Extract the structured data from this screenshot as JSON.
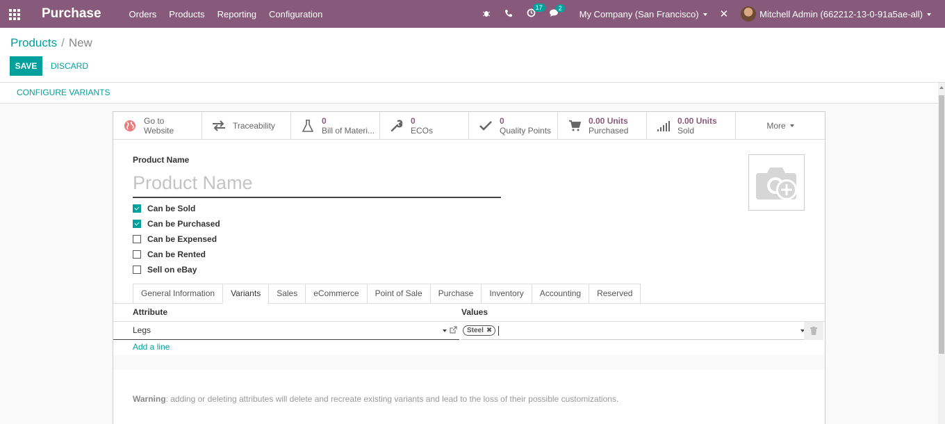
{
  "topbar": {
    "app_name": "Purchase",
    "menu": [
      "Orders",
      "Products",
      "Reporting",
      "Configuration"
    ],
    "activity_count": "17",
    "messages_count": "2",
    "company": "My Company (San Francisco)",
    "user": "Mitchell Admin (662212-13-0-91a5ae-all)"
  },
  "breadcrumb": {
    "parent": "Products",
    "separator": "/",
    "current": "New"
  },
  "actions": {
    "save": "SAVE",
    "discard": "DISCARD"
  },
  "statusbar": {
    "configure": "CONFIGURE VARIANTS"
  },
  "smart_buttons": [
    {
      "value": "",
      "line1": "Go to",
      "line2": "Website",
      "icon": "globe-icon"
    },
    {
      "value": "",
      "line1": "",
      "line2": "Traceability",
      "icon": "arrows-icon"
    },
    {
      "value": "0",
      "line1": "",
      "line2": "Bill of Materi...",
      "icon": "flask-icon"
    },
    {
      "value": "0",
      "line1": "",
      "line2": "ECOs",
      "icon": "wrench-icon"
    },
    {
      "value": "0",
      "line1": "",
      "line2": "Quality Points",
      "icon": "check-icon"
    },
    {
      "value": "0.00 Units",
      "line1": "",
      "line2": "Purchased",
      "icon": "cart-icon"
    },
    {
      "value": "0.00 Units",
      "line1": "",
      "line2": "Sold",
      "icon": "signal-icon"
    }
  ],
  "more_label": "More",
  "form": {
    "name_label": "Product Name",
    "name_placeholder": "Product Name",
    "checkboxes": [
      {
        "label": "Can be Sold",
        "checked": true
      },
      {
        "label": "Can be Purchased",
        "checked": true
      },
      {
        "label": "Can be Expensed",
        "checked": false
      },
      {
        "label": "Can be Rented",
        "checked": false
      },
      {
        "label": "Sell on eBay",
        "checked": false
      }
    ]
  },
  "tabs": [
    "General Information",
    "Variants",
    "Sales",
    "eCommerce",
    "Point of Sale",
    "Purchase",
    "Inventory",
    "Accounting",
    "Reserved"
  ],
  "active_tab": "Variants",
  "variants": {
    "col_attribute": "Attribute",
    "col_values": "Values",
    "row": {
      "attribute": "Legs",
      "value_tag": "Steel"
    },
    "add_line": "Add a line",
    "warning_title": "Warning",
    "warning_text": ": adding or deleting attributes will delete and recreate existing variants and lead to the loss of their possible customizations."
  },
  "colors": {
    "brand": "#875a7b",
    "accent": "#00a09d"
  }
}
